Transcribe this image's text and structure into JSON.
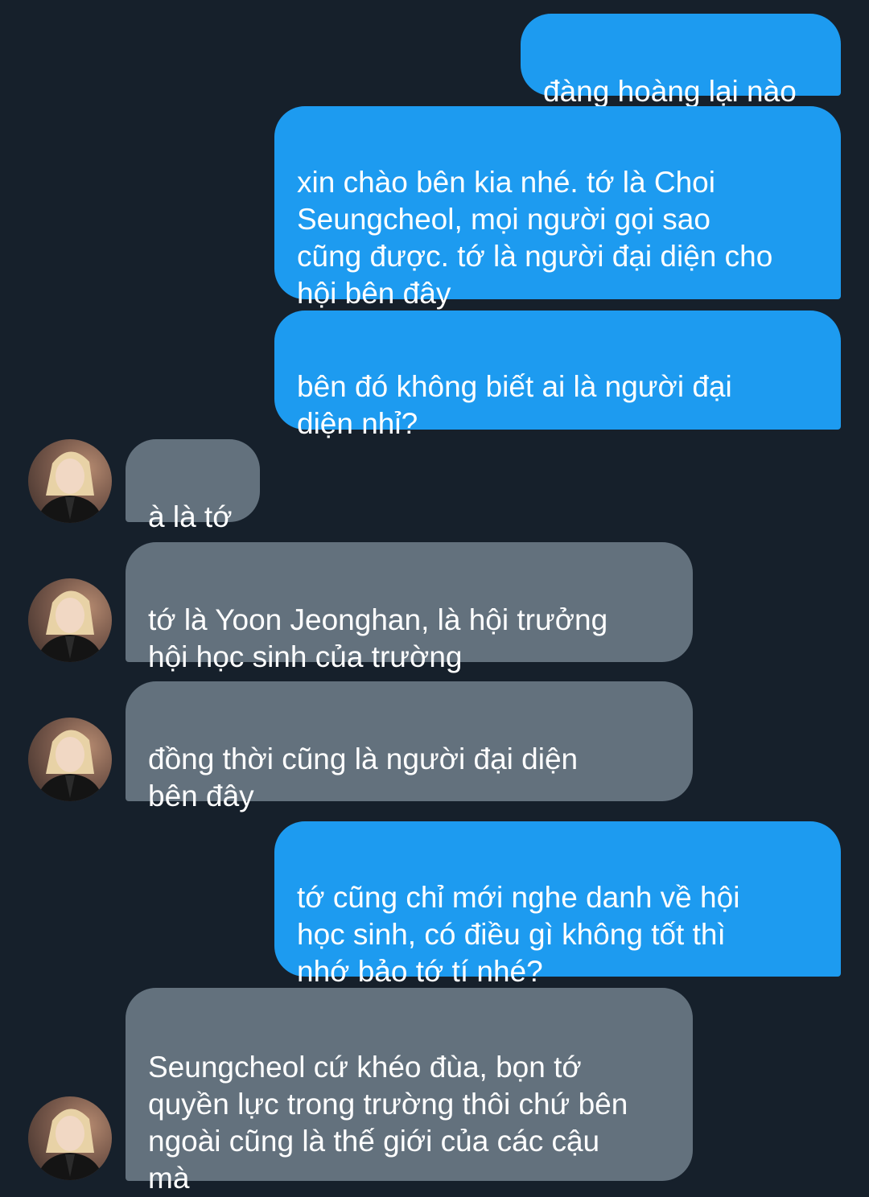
{
  "messages": [
    {
      "side": "sent",
      "text": "đàng hoàng lại nào"
    },
    {
      "side": "sent",
      "text": "xin chào bên kia nhé. tớ là Choi\nSeungcheol, mọi người gọi sao\ncũng được. tớ là người đại diện cho\nhội bên đây"
    },
    {
      "side": "sent",
      "text": "bên đó không biết ai là người đại\ndiện nhỉ?"
    },
    {
      "side": "received",
      "text": "à là tớ"
    },
    {
      "side": "received",
      "text": "tớ là Yoon Jeonghan, là hội trưởng\nhội học sinh của trường"
    },
    {
      "side": "received",
      "text": "đồng thời cũng là người đại diện\nbên đây"
    },
    {
      "side": "sent",
      "text": "tớ cũng chỉ mới nghe danh về hội\nhọc sinh, có điều gì không tốt thì\nnhớ bảo tớ tí nhé?"
    },
    {
      "side": "received",
      "text": "Seungcheol cứ khéo đùa, bọn tớ\nquyền lực trong trường thôi chứ bên\nngoài cũng là thế giới của các cậu\nmà"
    }
  ],
  "avatar_icon": "profile-photo",
  "colors": {
    "background": "#16202b",
    "sent_bubble": "#1d9bf0",
    "received_bubble": "#63717d",
    "text": "#ffffff"
  }
}
